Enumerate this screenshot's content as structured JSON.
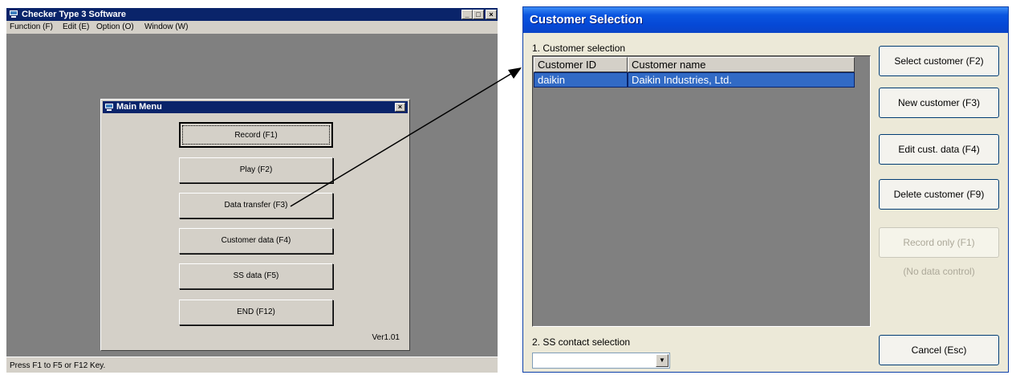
{
  "left_window": {
    "title": "Checker Type 3 Software",
    "controls": {
      "minimize": "_",
      "maximize": "□",
      "close": "×"
    },
    "menu": [
      "Function (F)",
      "Edit (E)",
      "Option (O)",
      "Window (W)"
    ],
    "status": "Press F1 to F5 or F12 Key.",
    "main_menu": {
      "title": "Main Menu",
      "close": "×",
      "buttons": [
        "Record (F1)",
        "Play (F2)",
        "Data transfer (F3)",
        "Customer data (F4)",
        "SS data (F5)",
        "END (F12)"
      ],
      "version": "Ver1.01"
    }
  },
  "right_window": {
    "title": "Customer Selection",
    "section1_label": "1. Customer selection",
    "columns": [
      "Customer ID",
      "Customer name"
    ],
    "rows": [
      {
        "id": "daikin",
        "name": "Daikin Industries, Ltd."
      }
    ],
    "buttons": {
      "select": "Select customer (F2)",
      "new": "New customer (F3)",
      "edit": "Edit cust. data (F4)",
      "delete": "Delete customer (F9)",
      "record_only": "Record only (F1)",
      "cancel": "Cancel (Esc)"
    },
    "no_data_control": "(No data control)",
    "section2_label": "2. SS contact selection",
    "ss_contact_value": "",
    "dropdown_arrow": "▼"
  }
}
